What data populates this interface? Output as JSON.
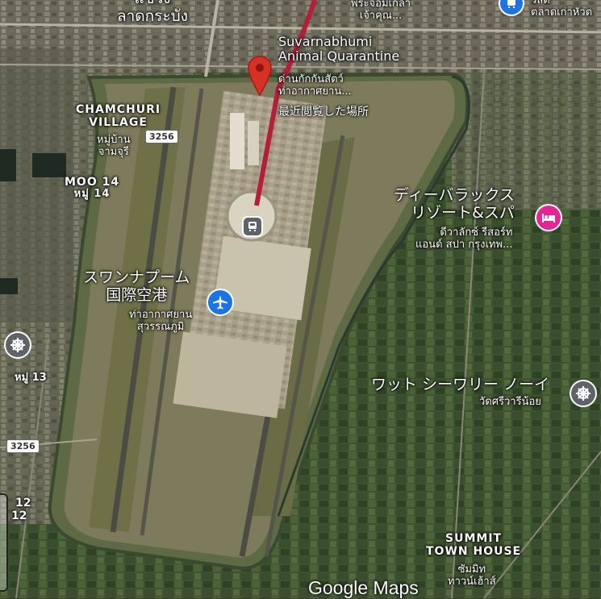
{
  "map": {
    "place_pin": {
      "name_lines": [
        "Suvarnabhumi",
        "Animal Quarantine"
      ],
      "thai_lines": [
        "ด่านกักกันสัตว์",
        "ท่าอากาศยาน..."
      ],
      "status": "最近閲覧した場所",
      "color": "#d93025"
    },
    "labels": {
      "top_district": "แขวง",
      "top_district_2": "ลาดกระบัง",
      "top_center_1": "พระจอมเกล้า",
      "top_center_2": "เจ้าคุณ...",
      "top_right_1": "ว์ลด์",
      "top_right_2": "ตลาดเก่าหัวต",
      "chamchuri": [
        "CHAMCHURI",
        "VILLAGE"
      ],
      "chamchuri_thai": [
        "หมู่บ้าน",
        "จามจุรี"
      ],
      "moo14": "MOO 14",
      "moo14_thai": "หมู่ 14",
      "airport": [
        "スワンナプーム",
        "国際空港"
      ],
      "airport_thai": [
        "ท่าอากาศยาน",
        "สุวรรณภูมิ"
      ],
      "resort": [
        "ディーバラックス",
        "リゾート&スパ"
      ],
      "resort_thai": [
        "ดีวาลักซ์ รีสอร์ท",
        "แอนด์ สปา กรุงเทพ..."
      ],
      "temple": "ワット シーワリー ノーイ",
      "temple_thai": "วัดศรีวารีน้อย",
      "moo13": "หมู่ 13",
      "moo12": [
        "12",
        "12"
      ],
      "summit": [
        "SUMMIT",
        "TOWN HOUSE"
      ],
      "summit_thai": [
        "ซัมมิท",
        "ทาวน์เฮ้าส์"
      ]
    },
    "route_shields": [
      "3256",
      "3256"
    ],
    "watermark": "Google Maps",
    "icons": {
      "pin": "map-pin-icon",
      "airport": "airplane-icon",
      "train": "train-icon",
      "hotel": "bed-icon",
      "temple": "temple-icon",
      "transit": "transit-icon"
    },
    "colors": {
      "airport_blue": "#1a73e8",
      "hotel_pink": "#e52592",
      "temple_grey": "#5f6368",
      "rail_red": "#b71c3a"
    }
  }
}
